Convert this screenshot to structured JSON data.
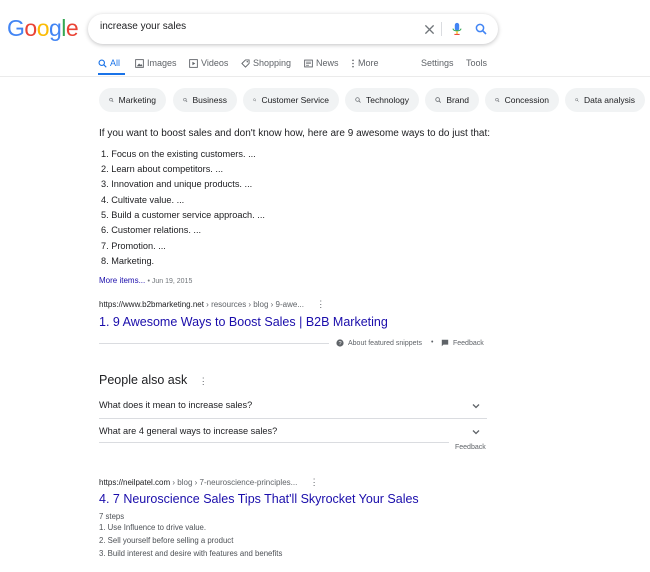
{
  "logo": {
    "letters": [
      "G",
      "o",
      "o",
      "g",
      "l",
      "e"
    ],
    "colors": [
      "#4285F4",
      "#EA4335",
      "#FBBC05",
      "#4285F4",
      "#34A853",
      "#EA4335"
    ]
  },
  "search": {
    "query": "increase your sales"
  },
  "tabs": [
    {
      "label": "All",
      "icon": "search-icon",
      "active": true
    },
    {
      "label": "Images",
      "icon": "image-icon"
    },
    {
      "label": "Videos",
      "icon": "video-icon"
    },
    {
      "label": "Shopping",
      "icon": "tag-icon"
    },
    {
      "label": "News",
      "icon": "newspaper-icon"
    },
    {
      "label": "More",
      "icon": "more-vert-icon"
    },
    {
      "label": "Settings"
    },
    {
      "label": "Tools"
    }
  ],
  "chips": [
    "Marketing",
    "Business",
    "Customer Service",
    "Technology",
    "Brand",
    "Concession",
    "Data analysis"
  ],
  "featured_snippet": {
    "intro": "If you want to boost sales and don't know how, here are 9 awesome ways to do just that:",
    "items": [
      "1. Focus on the existing customers. ...",
      "2. Learn about competitors. ...",
      "3. Innovation and unique products. ...",
      "4. Cultivate value. ...",
      "5. Build a customer service approach. ...",
      "6. Customer relations. ...",
      "7. Promotion. ...",
      "8. Marketing."
    ],
    "more_items": "More items...",
    "date": "• Jun 19, 2015",
    "url_domain": "https://www.b2bmarketing.net",
    "url_path": " › resources › blog › 9-awe...",
    "title": "1. 9 Awesome Ways to Boost Sales | B2B Marketing",
    "about": "About featured snippets",
    "bullet": "•",
    "feedback": "Feedback"
  },
  "people_also_ask": {
    "title": "People also ask",
    "questions": [
      "What does it mean to increase sales?",
      "What are 4 general ways to increase sales?"
    ],
    "feedback": "Feedback"
  },
  "result2": {
    "url_domain": "https://neilpatel.com",
    "url_path": " › blog › 7-neuroscience-principles...",
    "title": "4. 7 Neuroscience Sales Tips That'll Skyrocket Your Sales",
    "steps_label": "7 steps",
    "steps": [
      "1.  Use Influence to drive value.",
      "2.  Sell yourself before selling a product",
      "3.  Build interest and desire with features and benefits"
    ]
  },
  "accent_colors": {
    "link": "#1a0dab",
    "active_tab": "#1a73e8",
    "chip_bg": "#f1f3f4"
  }
}
